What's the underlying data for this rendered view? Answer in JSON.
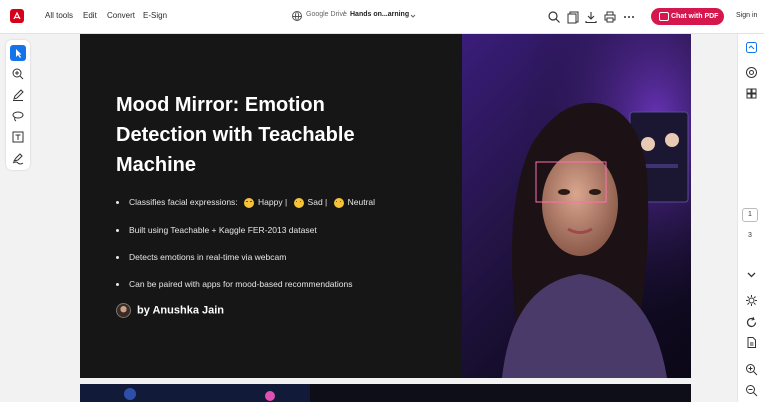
{
  "topbar": {
    "menu": [
      "All tools",
      "Edit",
      "Convert",
      "E-Sign"
    ],
    "location": "Google Drive",
    "separator": "/",
    "file_name": "Hands on...arning",
    "chat_button": "Chat with PDF",
    "sign_in": "Sign in",
    "brand_color": "#d7001a",
    "accent_color": "#d5174e"
  },
  "left_tools": [
    "select-icon",
    "comment-icon",
    "draw-icon",
    "lasso-icon",
    "text-icon",
    "fill-sign-icon"
  ],
  "right_panel": {
    "icons": [
      "ai-assistant-icon",
      "comments-icon",
      "grid-icon",
      "chevron-down-icon",
      "brightness-icon",
      "refresh-icon",
      "page-icon",
      "zoom-in-icon",
      "zoom-out-icon"
    ],
    "current_page": "1",
    "total_pages": "3"
  },
  "slide": {
    "title": "Mood Mirror: Emotion Detection with Teachable Machine",
    "bullet1": {
      "prefix": "Classifies facial expressions:",
      "happy": "Happy |",
      "sad": "Sad |",
      "neutral": "Neutral"
    },
    "bullets": [
      "Built using Teachable + Kaggle FER-2013 dataset",
      "Detects emotions in real-time via webcam",
      "Can be paired with apps for mood-based recommendations"
    ],
    "author": "by Anushka Jain"
  }
}
